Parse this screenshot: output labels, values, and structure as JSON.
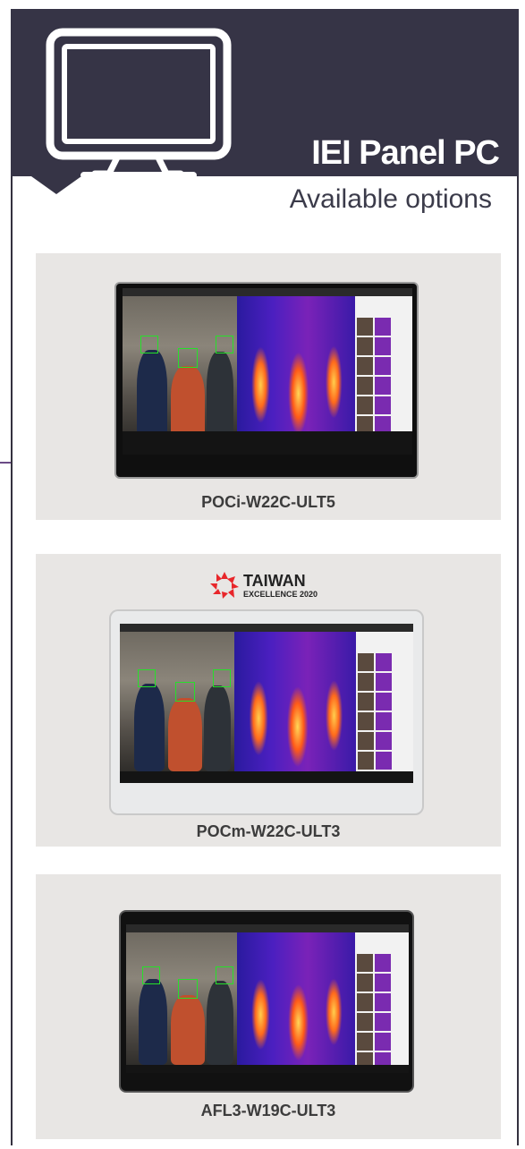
{
  "header": {
    "title": "IEI Panel PC",
    "subtitle": "Available options"
  },
  "products": [
    {
      "name": "POCi-W22C-ULT5",
      "bezel": "black"
    },
    {
      "name": "POCm-W22C-ULT3",
      "bezel": "white"
    },
    {
      "name": "AFL3-W19C-ULT3",
      "bezel": "black"
    }
  ],
  "badge": {
    "line1": "TAIWAN",
    "line2": "EXCELLENCE 2020",
    "color": "#e8262a"
  },
  "colors": {
    "header_bg": "#363446",
    "card_bg": "#e8e6e4",
    "face_box": "#26e02a"
  },
  "icons": [
    "monitor-icon",
    "taiwan-excellence-logo"
  ]
}
